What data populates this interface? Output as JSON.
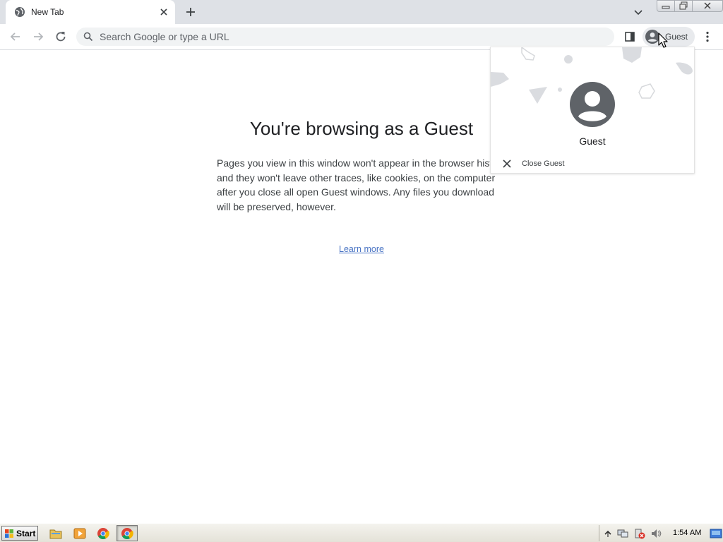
{
  "browser": {
    "tab": {
      "title": "New Tab",
      "favicon": "globe-icon"
    },
    "omnibox": {
      "placeholder": "Search Google or type a URL"
    },
    "profile_chip": {
      "label": "Guest"
    }
  },
  "page": {
    "title": "You're browsing as a Guest",
    "body": "Pages you view in this window won't appear in the browser history and they won't leave other traces, like cookies, on the computer after you close all open Guest windows. Any files you download will be preserved, however.",
    "learn_more": "Learn more"
  },
  "profile_menu": {
    "name": "Guest",
    "close_label": "Close Guest"
  },
  "taskbar": {
    "start_label": "Start",
    "clock": "1:54 AM",
    "quick_launch": [
      "folder-icon",
      "media-player-icon",
      "chrome-icon"
    ],
    "active_task": "chrome-icon"
  },
  "colors": {
    "tabstrip": "#dee1e6",
    "omnibox": "#f1f3f4",
    "link": "#4a74c4",
    "avatar": "#5f6368"
  }
}
